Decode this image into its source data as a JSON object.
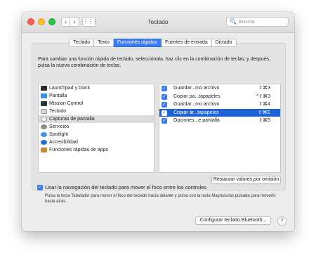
{
  "window": {
    "title": "Teclado"
  },
  "toolbar": {
    "back_label": "‹",
    "forward_label": "›",
    "grid_label": "⋮⋮⋮",
    "search_placeholder": "Buscar",
    "search_icon": "🔍"
  },
  "tabs": [
    {
      "label": "Teclado",
      "active": false
    },
    {
      "label": "Texto",
      "active": false
    },
    {
      "label": "Funciones rápidas",
      "active": true
    },
    {
      "label": "Fuentes de entrada",
      "active": false
    },
    {
      "label": "Dictado",
      "active": false
    }
  ],
  "description": "Para cambiar una función rápida de teclado, selecciónala, haz clic en la combinación de teclas, y después, pulsa la nueva combinación de teclas.",
  "categories": [
    {
      "label": "Launchpad y Dock",
      "icon": "launchpad-icon",
      "selected": false
    },
    {
      "label": "Pantalla",
      "icon": "display-icon",
      "selected": false
    },
    {
      "label": "Mission Control",
      "icon": "mission-control-icon",
      "selected": false
    },
    {
      "label": "Teclado",
      "icon": "keyboard-icon",
      "selected": false
    },
    {
      "label": "Capturas de pantalla",
      "icon": "screenshot-icon",
      "selected": true
    },
    {
      "label": "Servicios",
      "icon": "gear-icon",
      "selected": false
    },
    {
      "label": "Spotlight",
      "icon": "spotlight-icon",
      "selected": false
    },
    {
      "label": "Accesibilidad",
      "icon": "accessibility-icon",
      "selected": false
    },
    {
      "label": "Funciones rápidas de apps",
      "icon": "app-shortcuts-icon",
      "selected": false
    }
  ],
  "shortcuts": [
    {
      "label": "Guardar...mo archivo",
      "keys": "⇧⌘3",
      "checked": true,
      "selected": false
    },
    {
      "label": "Copiar pa...tapapeles",
      "keys": "^⇧⌘3",
      "checked": true,
      "selected": false
    },
    {
      "label": "Guardar...mo archivo",
      "keys": "⇧⌘4",
      "checked": true,
      "selected": false
    },
    {
      "label": "Copiar ár...tapapeles",
      "keys": "⇧⌘E",
      "checked": true,
      "selected": true
    },
    {
      "label": "Opciones...e pantalla",
      "keys": "⇧⌘5",
      "checked": true,
      "selected": false
    }
  ],
  "restore_button": "Restaurar valores por omisión",
  "keyboard_navigation": {
    "checked": true,
    "label": "Usar la navegación del teclado para mover el foco entre los controles",
    "hint": "Pulsa la tecla Tabulador para mover el foco del teclado hacia delante y pulsa con la tecla Mayúsculas pulsada para moverlo hacia atrás."
  },
  "bluetooth_button": "Configurar teclado Bluetooth...",
  "help_label": "?",
  "colors": {
    "accent": "#3a7cf1",
    "selection": "#1f62d6",
    "close": "#fc5f57",
    "minimize": "#fdbc2e",
    "maximize": "#28c840"
  }
}
